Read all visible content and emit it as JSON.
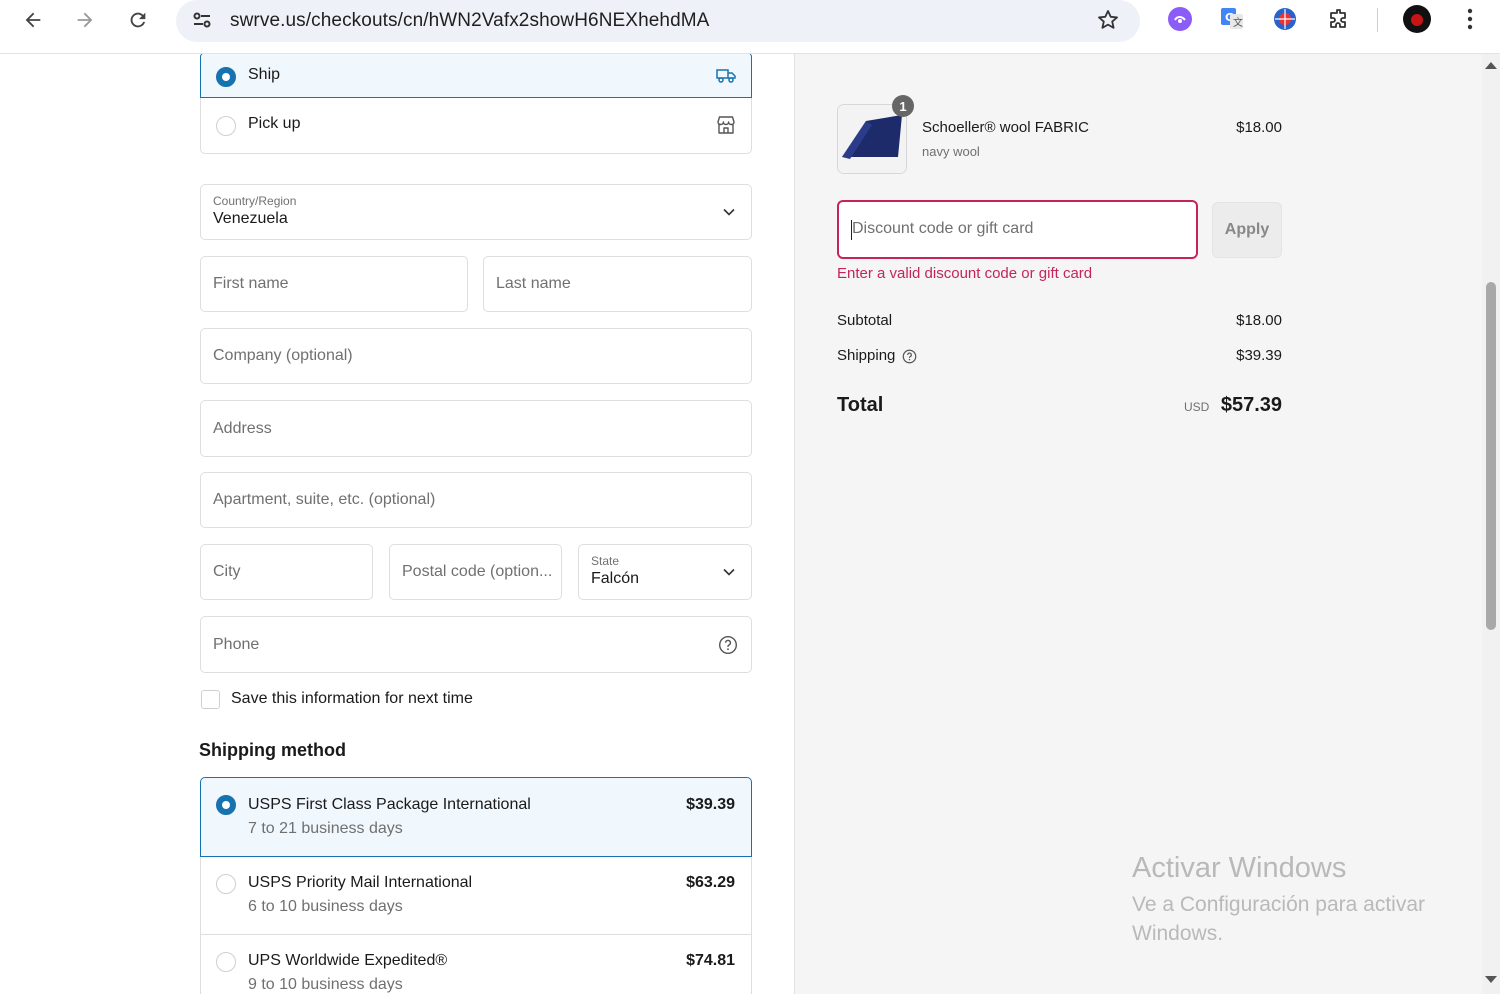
{
  "browser": {
    "url": "swrve.us/checkouts/cn/hWN2Vafx2showH6NEXhehdMA"
  },
  "delivery": {
    "options": [
      {
        "label": "Ship",
        "selected": true
      },
      {
        "label": "Pick up",
        "selected": false
      }
    ]
  },
  "address": {
    "country_label": "Country/Region",
    "country_value": "Venezuela",
    "first_name_placeholder": "First name",
    "last_name_placeholder": "Last name",
    "company_placeholder": "Company (optional)",
    "address_placeholder": "Address",
    "apartment_placeholder": "Apartment, suite, etc. (optional)",
    "city_placeholder": "City",
    "postal_placeholder": "Postal code (option...",
    "state_label": "State",
    "state_value": "Falcón",
    "phone_placeholder": "Phone",
    "save_info_label": "Save this information for next time"
  },
  "shipping_method": {
    "heading": "Shipping method",
    "options": [
      {
        "name": "USPS First Class Package International",
        "days": "7 to 21 business days",
        "price": "$39.39",
        "selected": true
      },
      {
        "name": "USPS Priority Mail International",
        "days": "6 to 10 business days",
        "price": "$63.29",
        "selected": false
      },
      {
        "name": "UPS Worldwide Expedited®",
        "days": "9 to 10 business days",
        "price": "$74.81",
        "selected": false
      }
    ]
  },
  "summary": {
    "item": {
      "quantity": "1",
      "name": "Schoeller® wool FABRIC",
      "variant": "navy wool",
      "price": "$18.00"
    },
    "discount_placeholder": "Discount code or gift card",
    "apply_label": "Apply",
    "discount_error": "Enter a valid discount code or gift card",
    "subtotal_label": "Subtotal",
    "subtotal_value": "$18.00",
    "shipping_label": "Shipping",
    "shipping_value": "$39.39",
    "total_label": "Total",
    "currency": "USD",
    "total_value": "$57.39"
  },
  "watermark": {
    "line1": "Activar Windows",
    "line2": "Ve a Configuración para activar Windows."
  },
  "colors": {
    "accent": "#1773b0",
    "error": "#c4245a"
  }
}
